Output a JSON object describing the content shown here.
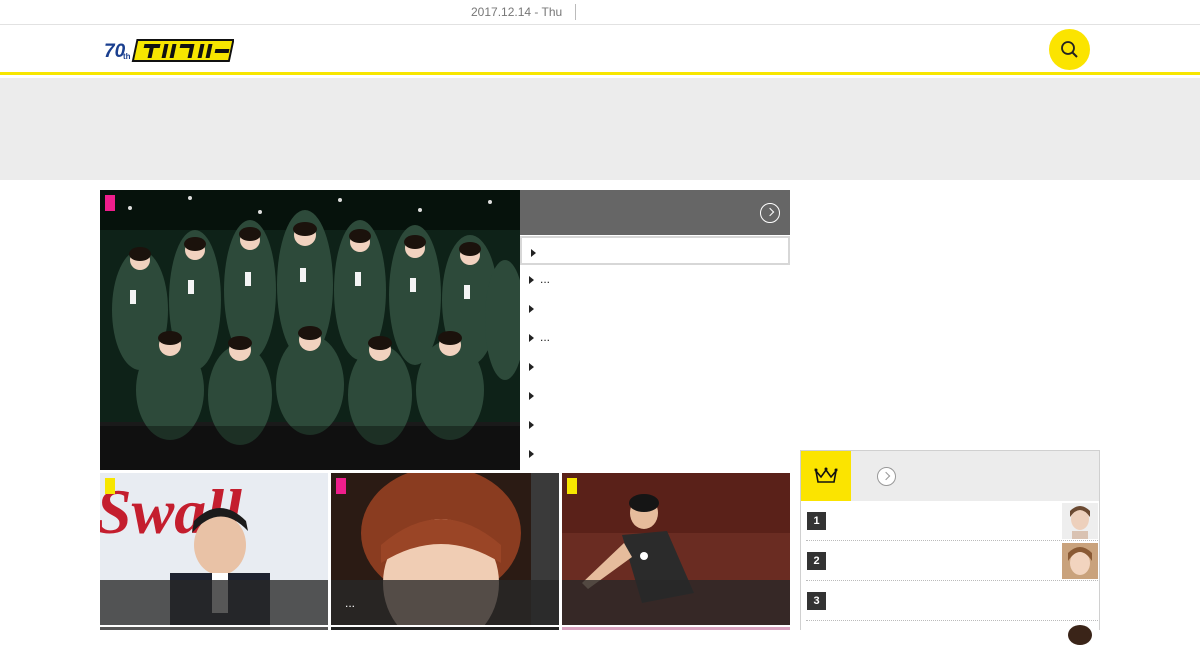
{
  "topbar": {
    "date": "2017.12.14 - Thu"
  },
  "header": {
    "logo_icon": "daily-logo",
    "search_icon": "search-icon",
    "accent_color": "#f7e600"
  },
  "hero": {
    "category_color": "#ef1e8c"
  },
  "headlines": {
    "more_icon": "chevron-right-circle-icon",
    "items": [
      {
        "text": ""
      },
      {
        "text": "..."
      },
      {
        "text": ""
      },
      {
        "text": "..."
      },
      {
        "text": ""
      },
      {
        "text": ""
      },
      {
        "text": ""
      },
      {
        "text": ""
      }
    ]
  },
  "thumbnails": [
    {
      "category_color": "#f7e600",
      "caption": ""
    },
    {
      "category_color": "#ef1e8c",
      "caption": "..."
    },
    {
      "category_color": "#f7e600",
      "caption": ""
    }
  ],
  "ranking": {
    "crown_icon": "crown-icon",
    "items": [
      {
        "rank": "1"
      },
      {
        "rank": "2"
      },
      {
        "rank": "3"
      }
    ]
  }
}
